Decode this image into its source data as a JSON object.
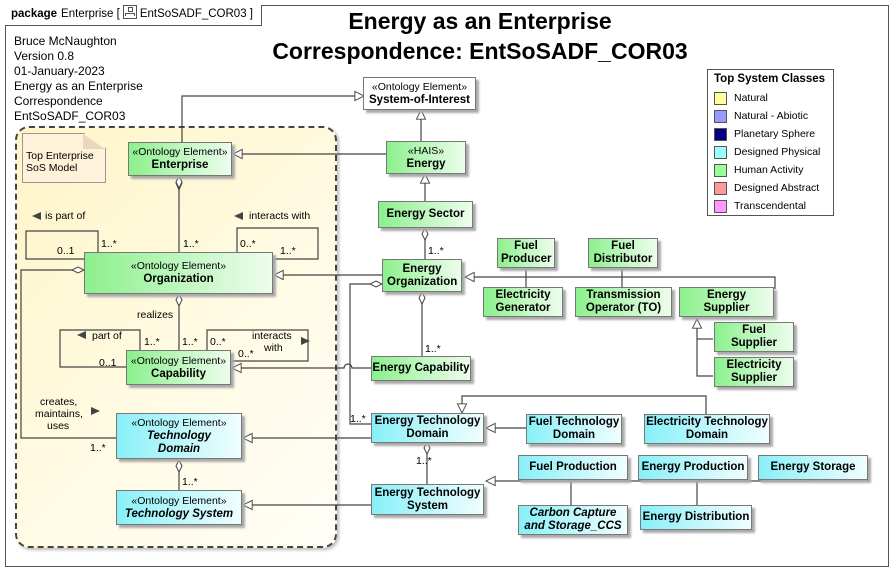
{
  "package_tab": {
    "keyword": "package",
    "name": "Enterprise",
    "diagram_name": "EntSoSADF_COR03"
  },
  "title": {
    "line1": "Energy as an Enterprise",
    "line2": "Correspondence:  EntSoSADF_COR03"
  },
  "info": [
    "Bruce McNaughton",
    "Version 0.8",
    "01-January-2023",
    "Energy as an Enterprise",
    "Correspondence",
    "EntSoSADF_COR03"
  ],
  "note": "Top Enterprise SoS Model",
  "legend": {
    "title": "Top System Classes",
    "items": [
      {
        "label": "Natural",
        "color": "#ffff99"
      },
      {
        "label": "Natural - Abiotic",
        "color": "#9999ff"
      },
      {
        "label": "Planetary Sphere",
        "color": "#000080"
      },
      {
        "label": "Designed Physical",
        "color": "#99ffff"
      },
      {
        "label": "Human Activity",
        "color": "#99ff99"
      },
      {
        "label": "Designed Abstract",
        "color": "#ff9999"
      },
      {
        "label": "Transcendental",
        "color": "#ff99ff"
      }
    ]
  },
  "elements": {
    "system_of_interest": {
      "stereotype": "«Ontology Element»",
      "name": "System-of-Interest"
    },
    "energy": {
      "stereotype": "«HAIS»",
      "name": "Energy"
    },
    "energy_sector": {
      "name": "Energy Sector"
    },
    "energy_organization": {
      "name": "Energy Organization"
    },
    "fuel_producer": {
      "name": "Fuel Producer"
    },
    "fuel_distributor": {
      "name": "Fuel Distributor"
    },
    "electricity_generator": {
      "name": "Electricity Generator"
    },
    "transmission_operator": {
      "name": "Transmission Operator (TO)"
    },
    "energy_supplier": {
      "name": "Energy Supplier"
    },
    "fuel_supplier": {
      "name": "Fuel Supplier"
    },
    "electricity_supplier": {
      "name": "Electricity Supplier"
    },
    "energy_capability": {
      "name": "Energy Capability"
    },
    "energy_technology_domain": {
      "name": "Energy Technology Domain"
    },
    "fuel_technology_domain": {
      "name": "Fuel Technology Domain"
    },
    "electricity_technology_domain": {
      "name": "Electricity Technology Domain"
    },
    "energy_technology_system": {
      "name": "Energy Technology System"
    },
    "fuel_production": {
      "name": "Fuel Production"
    },
    "energy_production": {
      "name": "Energy Production"
    },
    "energy_storage": {
      "name": "Energy Storage"
    },
    "carbon_capture": {
      "name": "Carbon Capture and Storage_CCS"
    },
    "energy_distribution": {
      "name": "Energy Distribution"
    },
    "enterprise": {
      "stereotype": "«Ontology Element»",
      "name": "Enterprise"
    },
    "organization": {
      "stereotype": "«Ontology Element»",
      "name": "Organization"
    },
    "capability": {
      "stereotype": "«Ontology Element»",
      "name": "Capability"
    },
    "technology_domain": {
      "stereotype": "«Ontology Element»",
      "name": "Technology Domain"
    },
    "technology_system": {
      "stereotype": "«Ontology Element»",
      "name": "Technology System"
    }
  },
  "labels": {
    "is_part_of": "is part of",
    "interacts_with": "interacts with",
    "realizes": "realizes",
    "part_of": "part of",
    "interacts": "interacts",
    "with": "with",
    "creates": "creates,",
    "maintains": "maintains,",
    "uses": "uses",
    "m_01": "0..1",
    "m_1n": "1..*",
    "m_0n": "0..*"
  }
}
